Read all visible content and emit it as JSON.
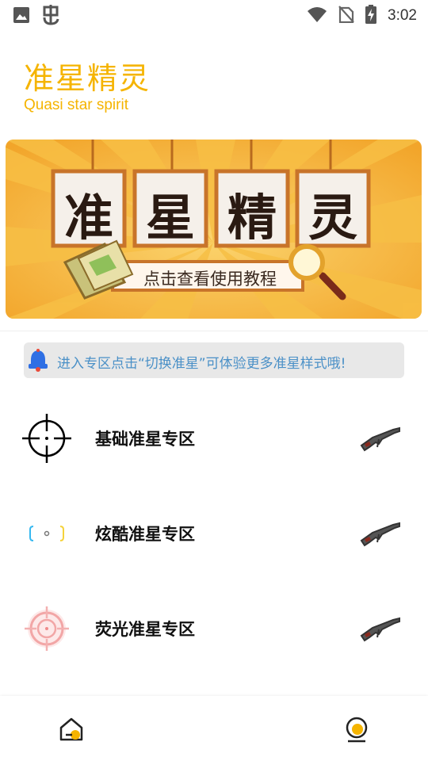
{
  "status_bar": {
    "time": "3:02",
    "left_icons": [
      "image-icon",
      "bug-icon"
    ],
    "right_icons": [
      "wifi-icon",
      "no-sim-icon",
      "battery-charging-icon"
    ]
  },
  "header": {
    "title": "准星精灵",
    "subtitle": "Quasi star spirit",
    "accent_color": "#f5b400"
  },
  "banner": {
    "characters": [
      "准",
      "星",
      "精",
      "灵"
    ],
    "caption": "点击查看使用教程"
  },
  "notice": {
    "icon": "bell-icon",
    "text": "进入专区点击“切换准星”可体验更多准星样式哦!"
  },
  "zones": [
    {
      "label": "基础准星专区",
      "icon": "basic-crosshair-icon"
    },
    {
      "label": "炫酷准星专区",
      "icon": "cool-crosshair-icon"
    },
    {
      "label": "荧光准星专区",
      "icon": "fluorescent-crosshair-icon"
    }
  ],
  "bottom_nav": {
    "items": [
      {
        "icon": "home-icon"
      },
      {
        "icon": "profile-icon"
      }
    ]
  }
}
